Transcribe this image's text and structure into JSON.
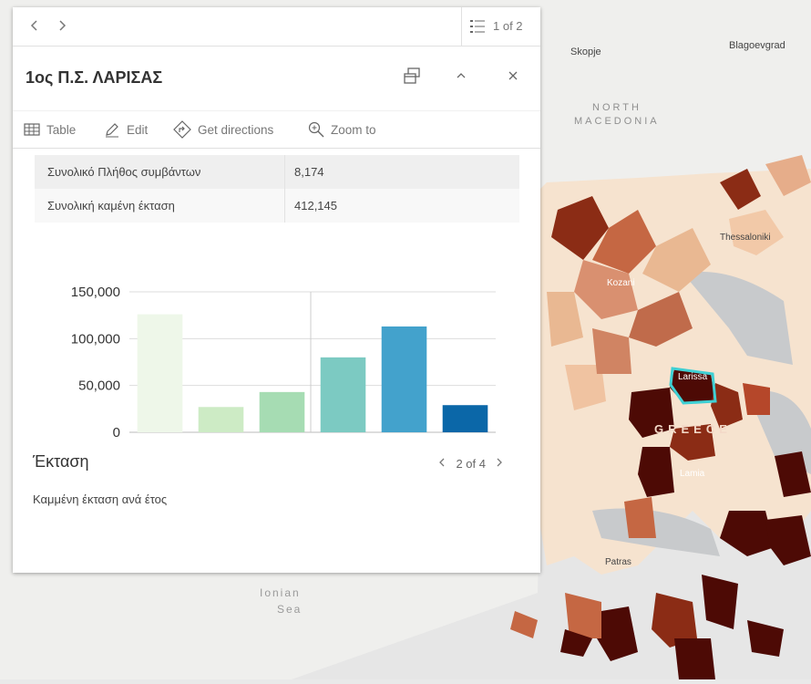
{
  "map": {
    "labels": {
      "skopje": "Skopje",
      "blagoevgrad": "Blagoevgrad",
      "north_macedonia_1": "NORTH",
      "north_macedonia_2": "MACEDONIA",
      "thessaloniki": "Thessaloniki",
      "kozani": "Kozani",
      "larissa": "Larissa",
      "greece": "GREECE",
      "lamia": "Lamia",
      "patras": "Patras",
      "ionian_1": "Ionian",
      "ionian_2": "Sea"
    },
    "colors": {
      "light": "#f6e3cf",
      "mid": "#dc9a72",
      "dark": "#8b2c15",
      "darkest": "#4d0a05",
      "highlight": "#3fd0d4",
      "sea": "#e6e6e6",
      "land": "#f2f1ef"
    }
  },
  "popup": {
    "feature_count": "1 of 2",
    "title": "1ος Π.Σ. ΛΑΡΙΣΑΣ",
    "actions": {
      "table": "Table",
      "edit": "Edit",
      "directions": "Get directions",
      "zoom": "Zoom to"
    },
    "fields": [
      {
        "name": "Συνολικό Πλήθος συμβάντων",
        "value": "8,174"
      },
      {
        "name": "Συνολική καμένη έκταση",
        "value": "412,145"
      }
    ],
    "chart_title": "Έκταση",
    "chart_page": "2 of 4",
    "chart_description": "Καμμένη έκταση ανά έτος"
  },
  "chart_data": {
    "type": "bar",
    "categories": [
      "",
      "",
      "",
      "",
      "",
      ""
    ],
    "values": [
      126000,
      27000,
      43000,
      80000,
      113000,
      29000
    ],
    "colors": [
      "#eef7e9",
      "#cdebc5",
      "#a6dcb3",
      "#7ccac2",
      "#43a2cc",
      "#0b67a8"
    ],
    "ylim": [
      0,
      150000
    ],
    "yticks": [
      0,
      50000,
      100000,
      150000
    ],
    "ytick_labels": [
      "0",
      "50,000",
      "100,000",
      "150,000"
    ],
    "grid": true
  }
}
